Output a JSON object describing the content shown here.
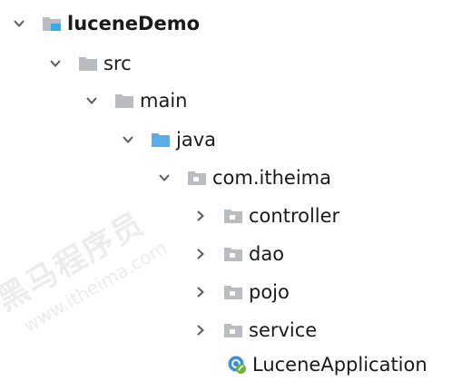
{
  "tree": {
    "root": {
      "label": "luceneDemo",
      "icon": "module-folder-icon",
      "expanded": true
    },
    "src": {
      "label": "src",
      "icon": "folder-icon",
      "expanded": true
    },
    "main": {
      "label": "main",
      "icon": "folder-icon",
      "expanded": true
    },
    "java": {
      "label": "java",
      "icon": "source-root-folder-icon",
      "expanded": true
    },
    "package": {
      "label": "com.itheima",
      "icon": "package-icon",
      "expanded": true
    },
    "children": [
      {
        "label": "controller",
        "icon": "package-icon",
        "expanded": false
      },
      {
        "label": "dao",
        "icon": "package-icon",
        "expanded": false
      },
      {
        "label": "pojo",
        "icon": "package-icon",
        "expanded": false
      },
      {
        "label": "service",
        "icon": "package-icon",
        "expanded": false
      }
    ],
    "class_file": {
      "label": "LuceneApplication",
      "icon": "spring-boot-class-icon"
    }
  },
  "watermark": {
    "line1": "黑马程序员",
    "line2": "www.itheima.com"
  },
  "colors": {
    "folder_gray": "#b9bcc1",
    "source_blue": "#5aaee6",
    "module_blue": "#40a8e8",
    "chevron": "#5a5a5a",
    "spring_green": "#6db33f",
    "class_blue": "#3d8fd6"
  }
}
